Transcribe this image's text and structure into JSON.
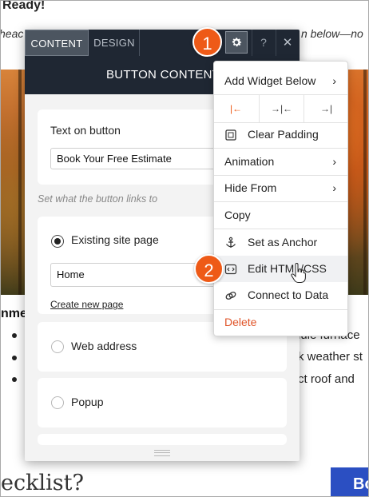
{
  "background": {
    "heading_fragment": "Ready!",
    "italic_left": "heac",
    "italic_right": "n below—no",
    "section_label": "nme",
    "bullet_lines": [
      "lule furnace",
      "k weather st",
      "ct roof and"
    ],
    "checklist_fragment": "ecklist?",
    "corner_button": "Bo"
  },
  "panel": {
    "tabs": [
      {
        "label": "CONTENT",
        "active": true
      },
      {
        "label": "DESIGN",
        "active": false
      }
    ],
    "help_label": "?",
    "close_label": "✕",
    "title": "BUTTON CONTENT",
    "text_on_button_label": "Text on button",
    "text_on_button_value": "Book Your Free Estimate",
    "links_help": "Set what the button links to",
    "link_options": [
      {
        "label": "Existing site page",
        "selected": true
      },
      {
        "label": "Web address",
        "selected": false
      },
      {
        "label": "Popup",
        "selected": false
      }
    ],
    "page_select_value": "Home",
    "create_page_link": "Create new page"
  },
  "menu": {
    "add_widget": "Add Widget Below",
    "clear_padding": "Clear Padding",
    "animation": "Animation",
    "hide_from": "Hide From",
    "copy": "Copy",
    "set_anchor": "Set as Anchor",
    "edit_html_css": "Edit HTML/CSS",
    "connect_data": "Connect to Data",
    "delete": "Delete",
    "delete_color": "#e0552a",
    "accent_color": "#ee5a17"
  },
  "badges": {
    "step1": "1",
    "step2": "2"
  }
}
